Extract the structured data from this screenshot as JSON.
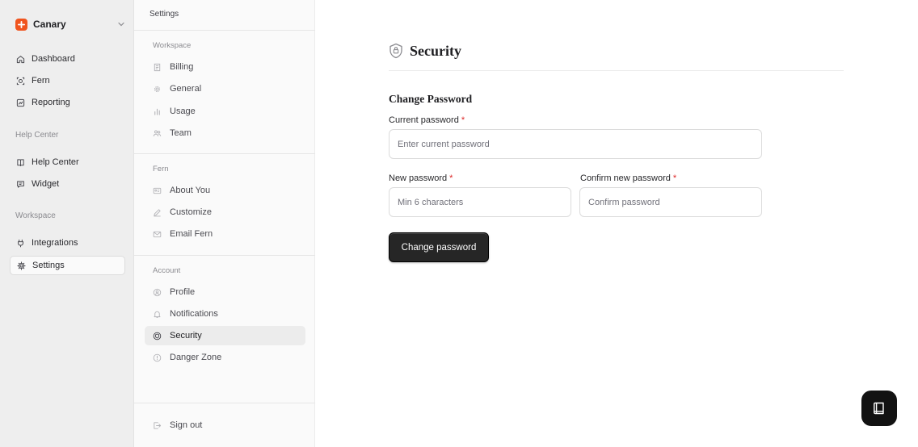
{
  "app": {
    "brand_name": "Canary",
    "brand_color": "#f0541e",
    "nav": [
      {
        "label": "Dashboard",
        "icon": "home-icon"
      },
      {
        "label": "Fern",
        "icon": "scan-face-icon"
      },
      {
        "label": "Reporting",
        "icon": "chart-icon"
      }
    ],
    "help_section": "Help Center",
    "help_nav": [
      {
        "label": "Help Center",
        "icon": "book-icon"
      },
      {
        "label": "Widget",
        "icon": "chat-icon"
      }
    ],
    "workspace_section": "Workspace",
    "workspace_nav": [
      {
        "label": "Integrations",
        "icon": "plug-icon"
      },
      {
        "label": "Settings",
        "icon": "gear-icon",
        "active": true
      }
    ]
  },
  "settings": {
    "title": "Settings",
    "workspace_section": "Workspace",
    "workspace_items": [
      "Billing",
      "General",
      "Usage",
      "Team"
    ],
    "fern_section": "Fern",
    "fern_items": [
      "About You",
      "Customize",
      "Email Fern"
    ],
    "account_section": "Account",
    "account_items": [
      "Profile",
      "Notifications",
      "Security",
      "Danger Zone"
    ],
    "active_item": "Security",
    "sign_out": "Sign out"
  },
  "page": {
    "title": "Security",
    "section": "Change Password",
    "current_label": "Current password",
    "current_placeholder": "Enter current password",
    "new_label": "New password",
    "new_placeholder": "Min 6 characters",
    "confirm_label": "Confirm new password",
    "confirm_placeholder": "Confirm password",
    "required_mark": "*",
    "submit_label": "Change password"
  }
}
